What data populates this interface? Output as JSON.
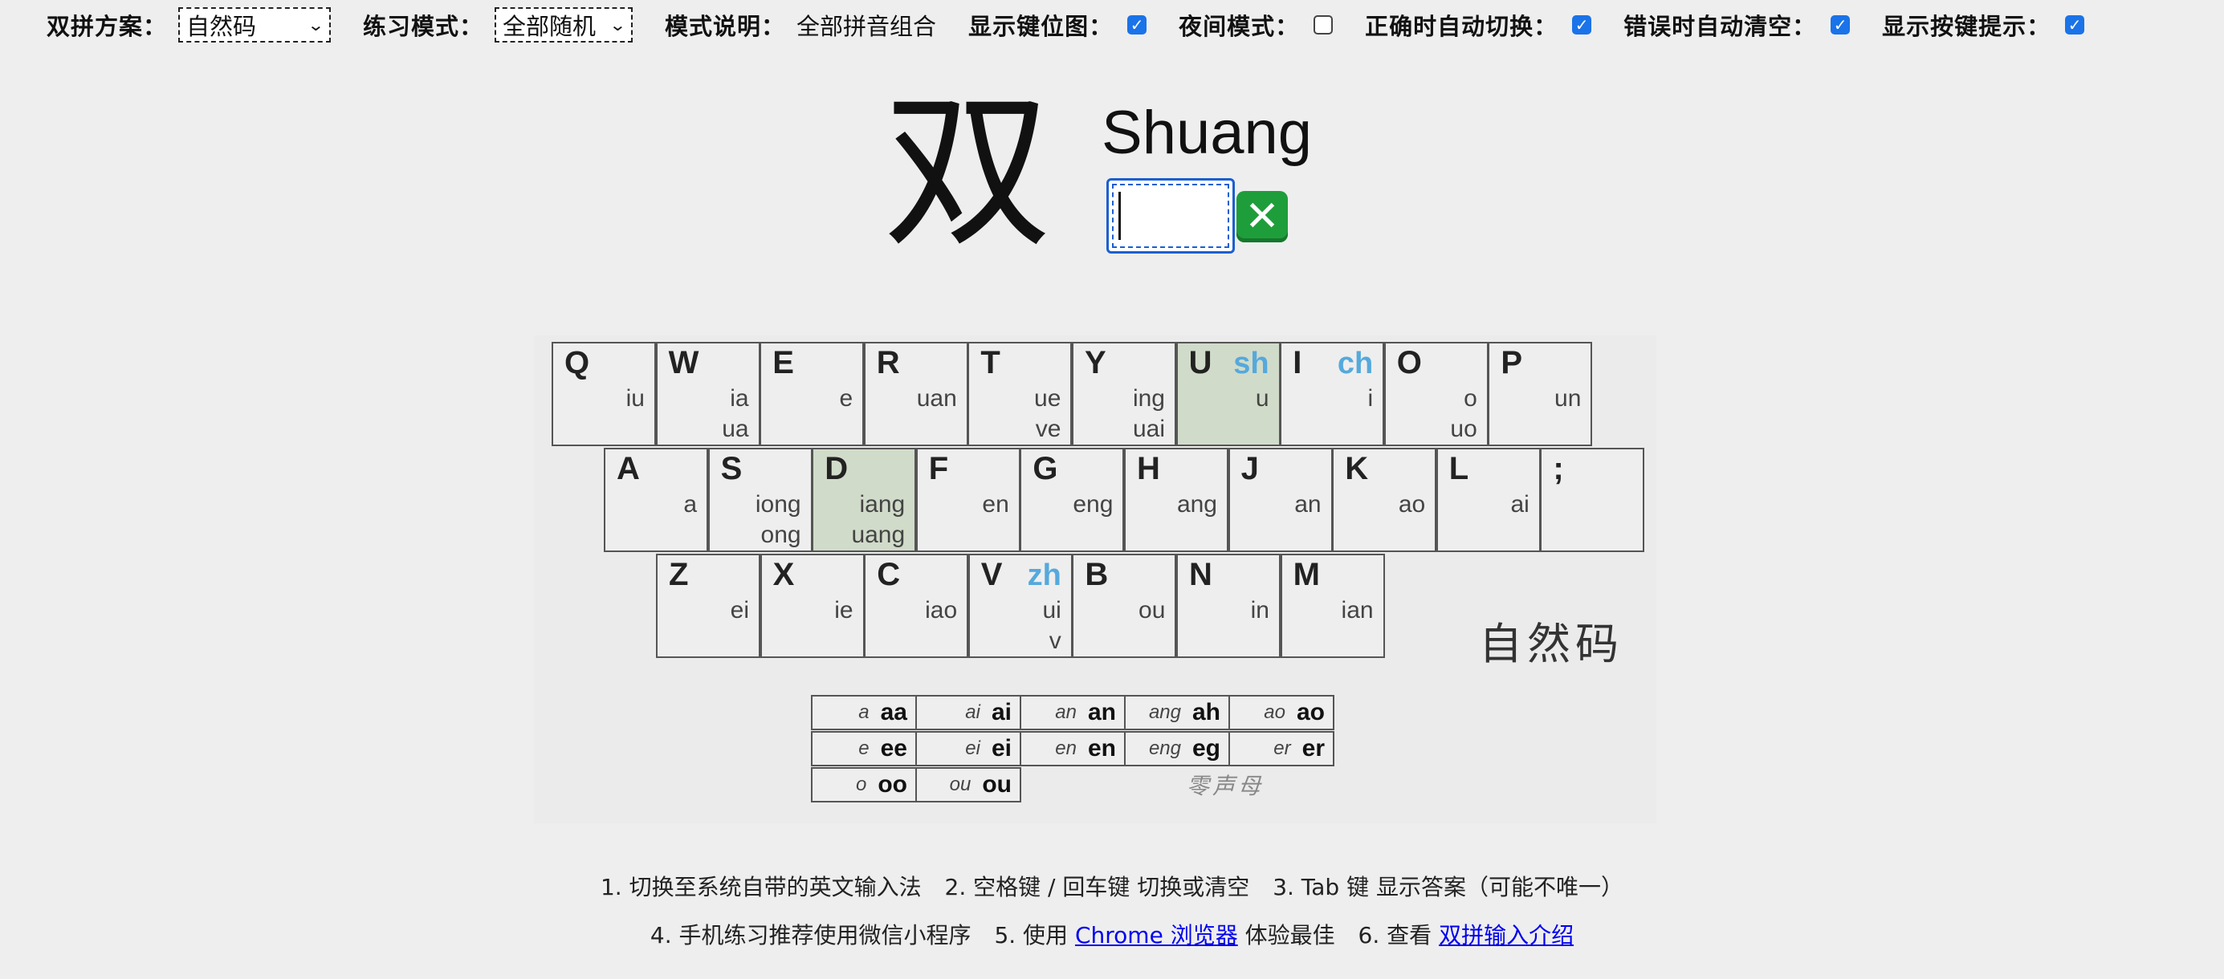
{
  "settings": {
    "scheme": {
      "label": "双拼方案：",
      "value": "自然码"
    },
    "mode": {
      "label": "练习模式：",
      "value": "全部随机"
    },
    "description": {
      "label": "模式说明：",
      "value": "全部拼音组合"
    },
    "show_keymap": {
      "label": "显示键位图：",
      "checked": true
    },
    "night_mode": {
      "label": "夜间模式：",
      "checked": false
    },
    "auto_next": {
      "label": "正确时自动切换：",
      "checked": true
    },
    "auto_clear": {
      "label": "错误时自动清空：",
      "checked": true
    },
    "show_hint": {
      "label": "显示按键提示：",
      "checked": true
    }
  },
  "practice": {
    "hanzi": "双",
    "pinyin": "Shuang",
    "input_value": "",
    "status_icon": "cross-mark-icon"
  },
  "keyboard": {
    "brand": "自然码",
    "highlight_color": "#d1dbca",
    "shengmu_color": "#55a9dc",
    "rows": [
      [
        {
          "key": "Q",
          "finals": [
            "iu"
          ]
        },
        {
          "key": "W",
          "finals": [
            "ia",
            "ua"
          ]
        },
        {
          "key": "E",
          "finals": [
            "e"
          ]
        },
        {
          "key": "R",
          "finals": [
            "uan"
          ]
        },
        {
          "key": "T",
          "finals": [
            "ue",
            "ve"
          ]
        },
        {
          "key": "Y",
          "finals": [
            "ing",
            "uai"
          ]
        },
        {
          "key": "U",
          "shengmu": "sh",
          "finals": [
            "u"
          ],
          "highlight": true
        },
        {
          "key": "I",
          "shengmu": "ch",
          "finals": [
            "i"
          ]
        },
        {
          "key": "O",
          "finals": [
            "o",
            "uo"
          ]
        },
        {
          "key": "P",
          "finals": [
            "un"
          ]
        }
      ],
      [
        {
          "key": "A",
          "finals": [
            "a"
          ]
        },
        {
          "key": "S",
          "finals": [
            "iong",
            "ong"
          ]
        },
        {
          "key": "D",
          "finals": [
            "iang",
            "uang"
          ],
          "highlight": true
        },
        {
          "key": "F",
          "finals": [
            "en"
          ]
        },
        {
          "key": "G",
          "finals": [
            "eng"
          ]
        },
        {
          "key": "H",
          "finals": [
            "ang"
          ]
        },
        {
          "key": "J",
          "finals": [
            "an"
          ]
        },
        {
          "key": "K",
          "finals": [
            "ao"
          ]
        },
        {
          "key": "L",
          "finals": [
            "ai"
          ]
        },
        {
          "key": ";",
          "finals": []
        }
      ],
      [
        {
          "key": "Z",
          "finals": [
            "ei"
          ]
        },
        {
          "key": "X",
          "finals": [
            "ie"
          ]
        },
        {
          "key": "C",
          "finals": [
            "iao"
          ]
        },
        {
          "key": "V",
          "shengmu": "zh",
          "finals": [
            "ui",
            "v"
          ]
        },
        {
          "key": "B",
          "finals": [
            "ou"
          ]
        },
        {
          "key": "N",
          "finals": [
            "in"
          ]
        },
        {
          "key": "M",
          "finals": [
            "ian"
          ]
        }
      ]
    ]
  },
  "zero_initial": {
    "label": "零声母",
    "rows": [
      [
        {
          "ex": "a",
          "code": "aa"
        },
        {
          "ex": "ai",
          "code": "ai"
        },
        {
          "ex": "an",
          "code": "an"
        },
        {
          "ex": "ang",
          "code": "ah"
        },
        {
          "ex": "ao",
          "code": "ao"
        }
      ],
      [
        {
          "ex": "e",
          "code": "ee"
        },
        {
          "ex": "ei",
          "code": "ei"
        },
        {
          "ex": "en",
          "code": "en"
        },
        {
          "ex": "eng",
          "code": "eg"
        },
        {
          "ex": "er",
          "code": "er"
        }
      ],
      [
        {
          "ex": "o",
          "code": "oo"
        },
        {
          "ex": "ou",
          "code": "ou"
        }
      ]
    ]
  },
  "footer": {
    "tip1": "1. 切换至系统自带的英文输入法",
    "tip2": "2. 空格键 / 回车键 切换或清空",
    "tip3": "3. Tab 键 显示答案（可能不唯一）",
    "tip4": "4. 手机练习推荐使用微信小程序",
    "tip5_prefix": "5. 使用",
    "tip5_link": "Chrome 浏览器",
    "tip5_suffix": "体验最佳",
    "tip6_prefix": "6. 查看",
    "tip6_link": "双拼输入介绍"
  }
}
